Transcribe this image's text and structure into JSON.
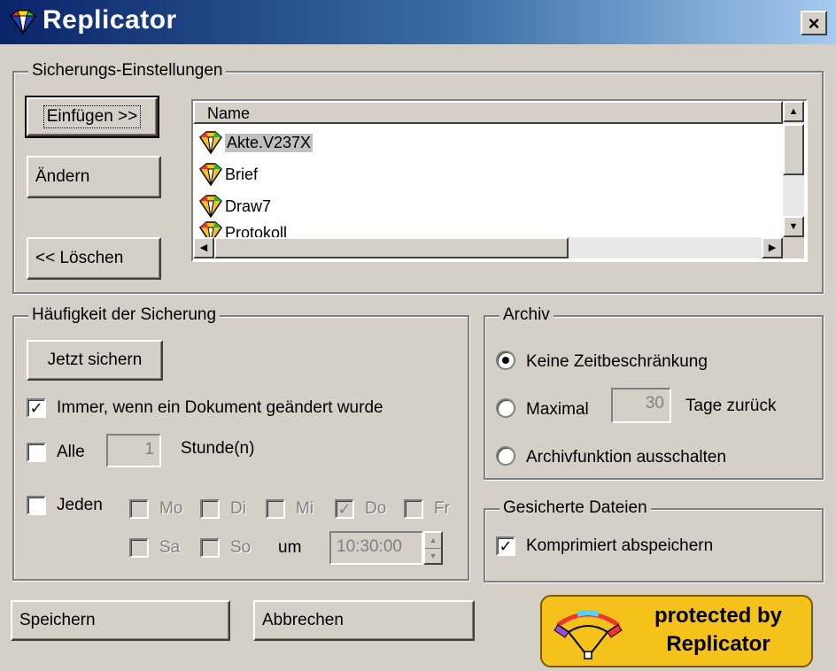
{
  "window": {
    "title": "Replicator",
    "close_label": "×"
  },
  "backup_settings": {
    "group_label": "Sicherungs-Einstellungen",
    "insert_button": "Einfügen >>",
    "edit_button": "Ändern",
    "delete_button": "<< Löschen",
    "list": {
      "column_header": "Name",
      "items": [
        {
          "name": "Akte.V237X",
          "selected": true
        },
        {
          "name": "Brief",
          "selected": false
        },
        {
          "name": "Draw7",
          "selected": false
        },
        {
          "name": "Protokoll",
          "selected": false
        }
      ]
    }
  },
  "frequency": {
    "group_label": "Häufigkeit der Sicherung",
    "backup_now_button": "Jetzt sichern",
    "always_checkbox": {
      "label": "Immer, wenn ein Dokument geändert wurde",
      "checked": true
    },
    "every_checkbox": {
      "label": "Alle",
      "checked": false
    },
    "every_value": "1",
    "every_unit": "Stunde(n)",
    "each_checkbox": {
      "label": "Jeden",
      "checked": false
    },
    "days": [
      {
        "label": "Mo",
        "checked": false
      },
      {
        "label": "Di",
        "checked": false
      },
      {
        "label": "Mi",
        "checked": false
      },
      {
        "label": "Do",
        "checked": true
      },
      {
        "label": "Fr",
        "checked": false
      },
      {
        "label": "Sa",
        "checked": false
      },
      {
        "label": "So",
        "checked": false
      }
    ],
    "at_label": "um",
    "time_value": "10:30:00"
  },
  "archive": {
    "group_label": "Archiv",
    "option_unlimited": "Keine Zeitbeschränkung",
    "option_maximal": "Maximal",
    "days_value": "30",
    "days_back_label": "Tage zurück",
    "option_disable": "Archivfunktion ausschalten",
    "selected_option": "unlimited"
  },
  "saved_files": {
    "group_label": "Gesicherte Dateien",
    "compress_checkbox": {
      "label": "Komprimiert abspeichern",
      "checked": true
    }
  },
  "footer": {
    "save_button": "Speichern",
    "cancel_button": "Abbrechen",
    "badge_line1": "protected by",
    "badge_line2": "Replicator"
  },
  "colors": {
    "title_gradient_start": "#0a246a",
    "title_gradient_end": "#a6caf0",
    "dialog_face": "#d4d0c8",
    "badge_yellow": "#f4c21a"
  },
  "icons": {
    "app": "replicator-diamond-icon",
    "list_item": "replicator-diamond-icon",
    "badge": "replicator-logo-icon"
  }
}
